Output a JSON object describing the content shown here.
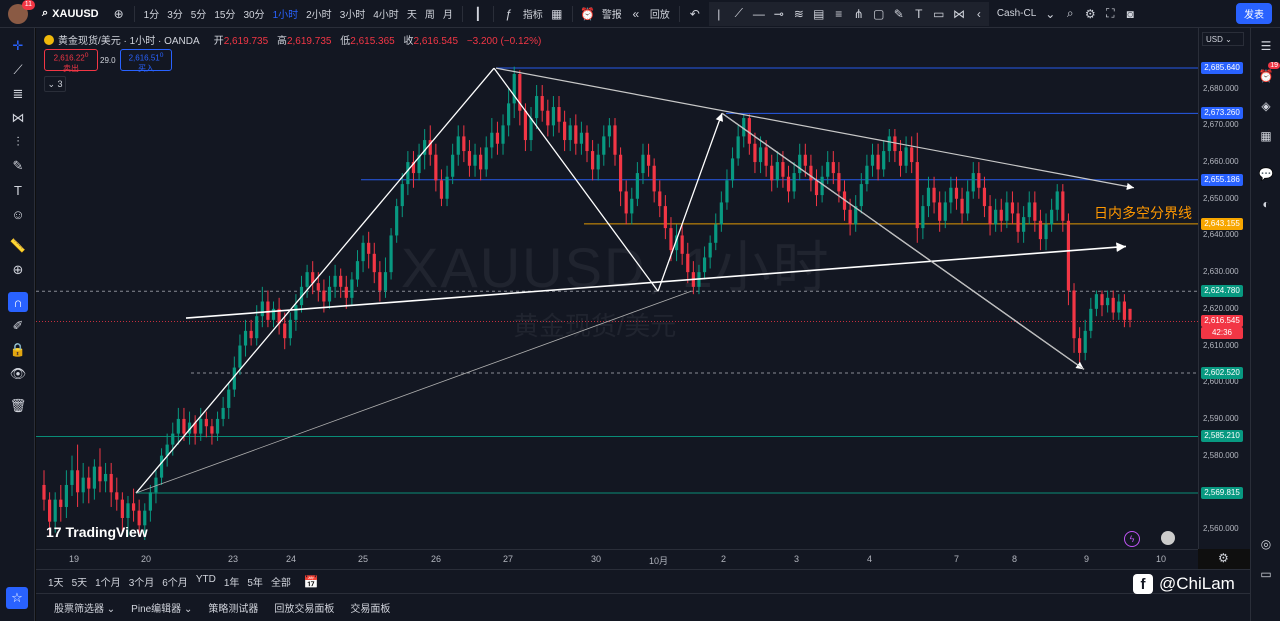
{
  "topbar": {
    "avatar_badge": "11",
    "symbol": "XAUUSD",
    "intervals": [
      "1分",
      "3分",
      "5分",
      "15分",
      "30分",
      "1小时",
      "2小时",
      "3小时",
      "4小时",
      "天",
      "周",
      "月"
    ],
    "active_interval": "1小时",
    "indicators_label": "指标",
    "alert_label": "警报",
    "replay_label": "回放",
    "layout_label": "Cash-CL",
    "publish_label": "发表"
  },
  "legend": {
    "title": "黄金现货/美元 · 1小时 · OANDA",
    "open_label": "开",
    "open": "2,619.735",
    "high_label": "高",
    "high": "2,619.735",
    "low_label": "低",
    "low": "2,615.365",
    "close_label": "收",
    "close": "2,616.545",
    "change": "−3.200 (−0.12%)",
    "sell_price": "2,616.22",
    "sell_sup": "0",
    "sell_label": "卖出",
    "spread": "29.0",
    "buy_price": "2,616.51",
    "buy_sup": "0",
    "buy_label": "买入",
    "collapse_count": "3"
  },
  "chart_overlay": {
    "watermark_symbol": "XAUUSD, 1小时",
    "watermark_name": "黄金现货/美元",
    "annotation": "日内多空分界线",
    "tradingview_logo": "TradingView",
    "facebook_handle": "@ChiLam"
  },
  "price_axis": {
    "currency": "USD",
    "ticks": [
      "2,680.000",
      "2,670.000",
      "2,660.000",
      "2,650.000",
      "2,640.000",
      "2,630.000",
      "2,620.000",
      "2,610.000",
      "2,600.000",
      "2,590.000",
      "2,580.000",
      "2,570.000",
      "2,560.000"
    ],
    "labels": [
      {
        "text": "2,685.640",
        "color": "#2962ff"
      },
      {
        "text": "2,673.260",
        "color": "#2962ff"
      },
      {
        "text": "2,655.186",
        "color": "#2962ff"
      },
      {
        "text": "2,643.155",
        "color": "#f7a600"
      },
      {
        "text": "2,624.780",
        "color": "#089981"
      },
      {
        "text": "2,616.545",
        "color": "#f23645"
      },
      {
        "text": "42:36",
        "color": "#f23645"
      },
      {
        "text": "2,602.520",
        "color": "#089981"
      },
      {
        "text": "2,585.210",
        "color": "#089981"
      },
      {
        "text": "2,569.815",
        "color": "#089981"
      }
    ]
  },
  "time_axis": {
    "ticks": [
      "19",
      "20",
      "23",
      "24",
      "25",
      "26",
      "27",
      "30",
      "10月",
      "2",
      "3",
      "4",
      "7",
      "8",
      "9",
      "10"
    ]
  },
  "range_bar": {
    "ranges": [
      "1天",
      "5天",
      "1个月",
      "3个月",
      "6个月",
      "YTD",
      "1年",
      "5年",
      "全部"
    ]
  },
  "bottom_bar": {
    "tabs": [
      "股票筛选器",
      "Pine编辑器",
      "策略测试器",
      "回放交易面板",
      "交易面板"
    ]
  },
  "right_panel": {
    "notification_count": "19"
  },
  "colors": {
    "up": "#089981",
    "down": "#f23645",
    "background": "#131722",
    "accent": "#2962ff"
  },
  "chart_data": {
    "type": "candlestick",
    "symbol": "XAUUSD",
    "interval": "1小时",
    "ylim": [
      2557,
      2690
    ],
    "horizontal_levels": [
      2685.64,
      2673.26,
      2655.186,
      2643.155,
      2624.78,
      2616.545,
      2602.52,
      2585.21,
      2569.815
    ],
    "candles": [
      [
        2572,
        2568,
        2576,
        2565
      ],
      [
        2568,
        2562,
        2570,
        2558
      ],
      [
        2562,
        2568,
        2570,
        2559
      ],
      [
        2568,
        2566,
        2572,
        2562
      ],
      [
        2566,
        2572,
        2576,
        2563
      ],
      [
        2572,
        2576,
        2580,
        2569
      ],
      [
        2576,
        2570,
        2583,
        2566
      ],
      [
        2570,
        2574,
        2578,
        2567
      ],
      [
        2574,
        2571,
        2577,
        2567
      ],
      [
        2571,
        2577,
        2579,
        2568
      ],
      [
        2577,
        2573,
        2582,
        2570
      ],
      [
        2573,
        2575,
        2578,
        2570
      ],
      [
        2575,
        2570,
        2578,
        2566
      ],
      [
        2570,
        2568,
        2574,
        2565
      ],
      [
        2568,
        2563,
        2570,
        2559
      ],
      [
        2563,
        2567,
        2569,
        2558
      ],
      [
        2567,
        2565,
        2571,
        2562
      ],
      [
        2565,
        2561,
        2568,
        2558
      ],
      [
        2561,
        2565,
        2567,
        2557
      ],
      [
        2565,
        2570,
        2572,
        2562
      ],
      [
        2570,
        2574,
        2576,
        2567
      ],
      [
        2574,
        2580,
        2582,
        2572
      ],
      [
        2580,
        2583,
        2586,
        2577
      ],
      [
        2583,
        2586,
        2589,
        2580
      ],
      [
        2586,
        2590,
        2593,
        2583
      ],
      [
        2590,
        2586,
        2593,
        2584
      ],
      [
        2586,
        2589,
        2592,
        2583
      ],
      [
        2589,
        2586,
        2591,
        2583
      ],
      [
        2586,
        2590,
        2593,
        2584
      ],
      [
        2590,
        2588,
        2592,
        2585
      ],
      [
        2588,
        2586,
        2590,
        2583
      ],
      [
        2586,
        2590,
        2592,
        2584
      ],
      [
        2590,
        2593,
        2596,
        2588
      ],
      [
        2593,
        2598,
        2600,
        2590
      ],
      [
        2598,
        2604,
        2607,
        2596
      ],
      [
        2604,
        2610,
        2613,
        2602
      ],
      [
        2610,
        2614,
        2617,
        2607
      ],
      [
        2614,
        2612,
        2617,
        2610
      ],
      [
        2612,
        2618,
        2621,
        2610
      ],
      [
        2618,
        2622,
        2626,
        2615
      ],
      [
        2622,
        2617,
        2625,
        2615
      ],
      [
        2617,
        2620,
        2622,
        2615
      ],
      [
        2620,
        2616,
        2623,
        2613
      ],
      [
        2616,
        2612,
        2619,
        2609
      ],
      [
        2612,
        2617,
        2619,
        2610
      ],
      [
        2617,
        2621,
        2624,
        2614
      ],
      [
        2621,
        2626,
        2629,
        2619
      ],
      [
        2626,
        2630,
        2632,
        2623
      ],
      [
        2630,
        2627,
        2633,
        2624
      ],
      [
        2627,
        2625,
        2630,
        2622
      ],
      [
        2625,
        2622,
        2628,
        2619
      ],
      [
        2622,
        2626,
        2629,
        2620
      ],
      [
        2626,
        2629,
        2632,
        2623
      ],
      [
        2629,
        2626,
        2631,
        2623
      ],
      [
        2626,
        2623,
        2629,
        2620
      ],
      [
        2623,
        2628,
        2630,
        2621
      ],
      [
        2628,
        2633,
        2636,
        2626
      ],
      [
        2633,
        2638,
        2640,
        2630
      ],
      [
        2638,
        2635,
        2641,
        2631
      ],
      [
        2635,
        2630,
        2638,
        2627
      ],
      [
        2630,
        2625,
        2633,
        2622
      ],
      [
        2625,
        2630,
        2634,
        2623
      ],
      [
        2630,
        2640,
        2642,
        2628
      ],
      [
        2640,
        2648,
        2650,
        2638
      ],
      [
        2648,
        2654,
        2657,
        2645
      ],
      [
        2654,
        2660,
        2663,
        2651
      ],
      [
        2660,
        2657,
        2663,
        2653
      ],
      [
        2657,
        2662,
        2665,
        2655
      ],
      [
        2662,
        2666,
        2669,
        2658
      ],
      [
        2666,
        2662,
        2670,
        2659
      ],
      [
        2662,
        2655,
        2665,
        2652
      ],
      [
        2655,
        2650,
        2658,
        2648
      ],
      [
        2650,
        2656,
        2659,
        2648
      ],
      [
        2656,
        2662,
        2665,
        2654
      ],
      [
        2662,
        2667,
        2670,
        2659
      ],
      [
        2667,
        2663,
        2670,
        2660
      ],
      [
        2663,
        2659,
        2666,
        2656
      ],
      [
        2659,
        2662,
        2665,
        2656
      ],
      [
        2662,
        2658,
        2664,
        2655
      ],
      [
        2658,
        2664,
        2667,
        2656
      ],
      [
        2664,
        2668,
        2672,
        2661
      ],
      [
        2668,
        2665,
        2671,
        2662
      ],
      [
        2665,
        2670,
        2673,
        2662
      ],
      [
        2670,
        2676,
        2680,
        2667
      ],
      [
        2676,
        2684,
        2686,
        2672
      ],
      [
        2684,
        2674,
        2685,
        2670
      ],
      [
        2674,
        2666,
        2676,
        2663
      ],
      [
        2666,
        2672,
        2675,
        2663
      ],
      [
        2672,
        2678,
        2681,
        2669
      ],
      [
        2678,
        2674,
        2681,
        2671
      ],
      [
        2674,
        2670,
        2677,
        2667
      ],
      [
        2670,
        2675,
        2678,
        2667
      ],
      [
        2675,
        2671,
        2678,
        2668
      ],
      [
        2671,
        2666,
        2674,
        2663
      ],
      [
        2666,
        2670,
        2672,
        2663
      ],
      [
        2670,
        2665,
        2673,
        2662
      ],
      [
        2665,
        2668,
        2671,
        2662
      ],
      [
        2668,
        2663,
        2670,
        2660
      ],
      [
        2663,
        2658,
        2666,
        2655
      ],
      [
        2658,
        2662,
        2665,
        2655
      ],
      [
        2662,
        2667,
        2670,
        2659
      ],
      [
        2667,
        2670,
        2672,
        2664
      ],
      [
        2670,
        2662,
        2672,
        2659
      ],
      [
        2662,
        2652,
        2664,
        2648
      ],
      [
        2652,
        2646,
        2655,
        2643
      ],
      [
        2646,
        2650,
        2653,
        2643
      ],
      [
        2650,
        2657,
        2660,
        2648
      ],
      [
        2657,
        2662,
        2665,
        2654
      ],
      [
        2662,
        2659,
        2665,
        2656
      ],
      [
        2659,
        2652,
        2661,
        2649
      ],
      [
        2652,
        2648,
        2655,
        2645
      ],
      [
        2648,
        2642,
        2651,
        2639
      ],
      [
        2642,
        2636,
        2645,
        2633
      ],
      [
        2636,
        2640,
        2643,
        2633
      ],
      [
        2640,
        2635,
        2643,
        2632
      ],
      [
        2635,
        2630,
        2638,
        2627
      ],
      [
        2630,
        2626,
        2633,
        2624
      ],
      [
        2626,
        2630,
        2632,
        2624
      ],
      [
        2630,
        2634,
        2637,
        2628
      ],
      [
        2634,
        2638,
        2640,
        2631
      ],
      [
        2638,
        2643,
        2646,
        2636
      ],
      [
        2643,
        2649,
        2652,
        2641
      ],
      [
        2649,
        2655,
        2658,
        2647
      ],
      [
        2655,
        2661,
        2664,
        2653
      ],
      [
        2661,
        2667,
        2670,
        2659
      ],
      [
        2667,
        2672,
        2673,
        2664
      ],
      [
        2672,
        2665,
        2673,
        2662
      ],
      [
        2665,
        2660,
        2668,
        2657
      ],
      [
        2660,
        2664,
        2667,
        2657
      ],
      [
        2664,
        2659,
        2666,
        2656
      ],
      [
        2659,
        2655,
        2662,
        2652
      ],
      [
        2655,
        2660,
        2663,
        2653
      ],
      [
        2660,
        2656,
        2663,
        2653
      ],
      [
        2656,
        2652,
        2659,
        2649
      ],
      [
        2652,
        2657,
        2660,
        2650
      ],
      [
        2657,
        2662,
        2665,
        2655
      ],
      [
        2662,
        2659,
        2665,
        2656
      ],
      [
        2659,
        2655,
        2662,
        2652
      ],
      [
        2655,
        2651,
        2658,
        2648
      ],
      [
        2651,
        2656,
        2659,
        2649
      ],
      [
        2656,
        2660,
        2663,
        2654
      ],
      [
        2660,
        2657,
        2663,
        2654
      ],
      [
        2657,
        2652,
        2660,
        2649
      ],
      [
        2652,
        2647,
        2655,
        2644
      ],
      [
        2647,
        2643,
        2650,
        2640
      ],
      [
        2643,
        2648,
        2651,
        2641
      ],
      [
        2648,
        2654,
        2657,
        2646
      ],
      [
        2654,
        2659,
        2662,
        2652
      ],
      [
        2659,
        2662,
        2665,
        2656
      ],
      [
        2662,
        2658,
        2665,
        2655
      ],
      [
        2658,
        2663,
        2666,
        2656
      ],
      [
        2663,
        2667,
        2669,
        2660
      ],
      [
        2667,
        2663,
        2669,
        2660
      ],
      [
        2663,
        2659,
        2666,
        2656
      ],
      [
        2659,
        2664,
        2667,
        2657
      ],
      [
        2664,
        2660,
        2667,
        2657
      ],
      [
        2660,
        2642,
        2668,
        2638
      ],
      [
        2642,
        2648,
        2651,
        2639
      ],
      [
        2648,
        2653,
        2656,
        2645
      ],
      [
        2653,
        2649,
        2656,
        2646
      ],
      [
        2649,
        2644,
        2652,
        2641
      ],
      [
        2644,
        2649,
        2652,
        2642
      ],
      [
        2649,
        2653,
        2656,
        2646
      ],
      [
        2653,
        2650,
        2656,
        2647
      ],
      [
        2650,
        2646,
        2653,
        2643
      ],
      [
        2646,
        2652,
        2655,
        2644
      ],
      [
        2652,
        2657,
        2660,
        2650
      ],
      [
        2657,
        2653,
        2660,
        2650
      ],
      [
        2653,
        2648,
        2656,
        2645
      ],
      [
        2648,
        2643,
        2651,
        2640
      ],
      [
        2643,
        2647,
        2650,
        2641
      ],
      [
        2647,
        2644,
        2650,
        2641
      ],
      [
        2644,
        2649,
        2652,
        2642
      ],
      [
        2649,
        2646,
        2652,
        2643
      ],
      [
        2646,
        2641,
        2649,
        2638
      ],
      [
        2641,
        2645,
        2648,
        2638
      ],
      [
        2645,
        2649,
        2652,
        2643
      ],
      [
        2649,
        2644,
        2652,
        2641
      ],
      [
        2644,
        2639,
        2647,
        2636
      ],
      [
        2639,
        2643,
        2646,
        2636
      ],
      [
        2643,
        2647,
        2650,
        2641
      ],
      [
        2647,
        2652,
        2654,
        2644
      ],
      [
        2652,
        2644,
        2654,
        2641
      ],
      [
        2644,
        2625,
        2646,
        2621
      ],
      [
        2625,
        2612,
        2627,
        2608
      ],
      [
        2612,
        2608,
        2615,
        2605
      ],
      [
        2608,
        2614,
        2617,
        2606
      ],
      [
        2614,
        2620,
        2623,
        2612
      ],
      [
        2620,
        2624,
        2625,
        2618
      ],
      [
        2624,
        2621,
        2625,
        2618
      ],
      [
        2621,
        2623,
        2625,
        2619
      ],
      [
        2623,
        2619,
        2625,
        2617
      ],
      [
        2619,
        2622,
        2624,
        2617
      ],
      [
        2622,
        2617,
        2624,
        2615
      ],
      [
        2620,
        2617,
        2620,
        2615
      ]
    ],
    "drawn_lines": [
      [
        2569.8,
        2685.6
      ],
      [
        2685.6,
        2624.8
      ],
      [
        2624.8,
        2673.3
      ],
      [
        2673.3,
        2603.5
      ],
      [
        2685.6,
        2653.0
      ],
      [
        2617.5,
        2637.0
      ],
      [
        2655.2,
        2655.2
      ],
      [
        2643.2,
        2643.2
      ]
    ]
  }
}
